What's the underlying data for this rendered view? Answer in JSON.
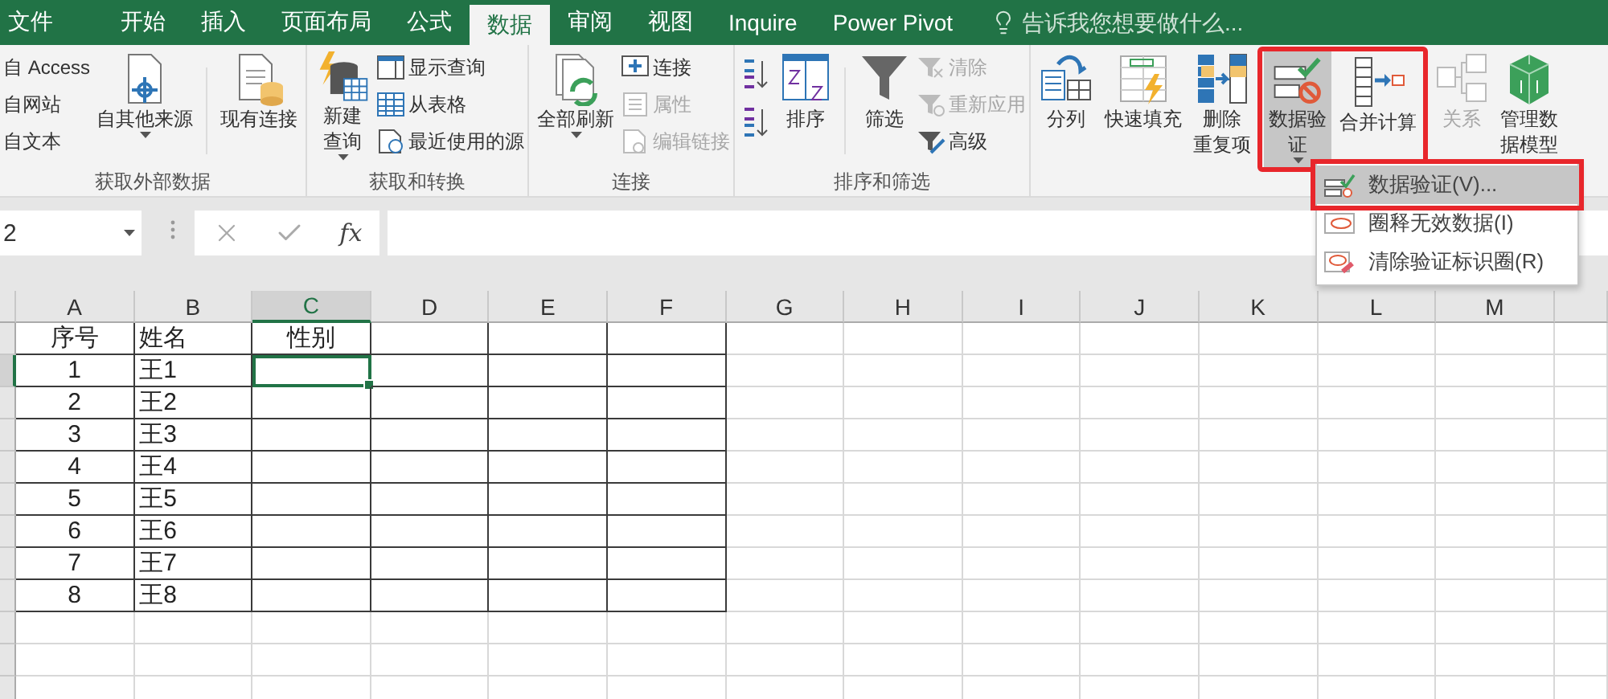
{
  "tabs": [
    {
      "label": "文件",
      "selected": false
    },
    {
      "label": "开始",
      "selected": false
    },
    {
      "label": "插入",
      "selected": false
    },
    {
      "label": "页面布局",
      "selected": false
    },
    {
      "label": "公式",
      "selected": false
    },
    {
      "label": "数据",
      "selected": true
    },
    {
      "label": "审阅",
      "selected": false
    },
    {
      "label": "视图",
      "selected": false
    },
    {
      "label": "Inquire",
      "selected": false
    },
    {
      "label": "Power Pivot",
      "selected": false
    }
  ],
  "tell_me": {
    "placeholder": "告诉我您想要做什么..."
  },
  "ribbon": {
    "groups": [
      {
        "label": "获取外部数据",
        "items": [
          {
            "kind": "stack",
            "items": [
              {
                "label": "自 Access",
                "disabled": false
              },
              {
                "label": "自网站",
                "disabled": false
              },
              {
                "label": "自文本",
                "disabled": false
              }
            ]
          },
          {
            "kind": "large",
            "lines": [
              "自其他来源"
            ],
            "dropdown": true,
            "disabled": false,
            "selected": false,
            "highlighted": false
          },
          {
            "kind": "separator"
          },
          {
            "kind": "large",
            "lines": [
              "现有连接"
            ],
            "dropdown": false,
            "disabled": false,
            "selected": false,
            "highlighted": false
          }
        ]
      },
      {
        "label": "获取和转换",
        "items": [
          {
            "kind": "large",
            "lines": [
              "新建",
              "查询"
            ],
            "dropdown": true,
            "disabled": false,
            "selected": false,
            "highlighted": false
          },
          {
            "kind": "stack",
            "items": [
              {
                "label": "显示查询",
                "disabled": false
              },
              {
                "label": "从表格",
                "disabled": false
              },
              {
                "label": "最近使用的源",
                "disabled": false
              }
            ]
          }
        ]
      },
      {
        "label": "连接",
        "items": [
          {
            "kind": "large",
            "lines": [
              "全部刷新"
            ],
            "dropdown": true,
            "disabled": false,
            "selected": false,
            "highlighted": false
          },
          {
            "kind": "stack",
            "items": [
              {
                "label": "连接",
                "disabled": false
              },
              {
                "label": "属性",
                "disabled": true
              },
              {
                "label": "编辑链接",
                "disabled": true
              }
            ]
          }
        ]
      },
      {
        "label": "排序和筛选",
        "items": [
          {
            "kind": "sort_icons"
          },
          {
            "kind": "large",
            "lines": [
              "排序"
            ],
            "dropdown": false,
            "disabled": false,
            "selected": false,
            "highlighted": false
          },
          {
            "kind": "separator"
          },
          {
            "kind": "large",
            "lines": [
              "筛选"
            ],
            "dropdown": false,
            "disabled": false,
            "selected": false,
            "highlighted": false
          },
          {
            "kind": "stack",
            "items": [
              {
                "label": "清除",
                "disabled": true
              },
              {
                "label": "重新应用",
                "disabled": true
              },
              {
                "label": "高级",
                "disabled": false
              }
            ]
          }
        ]
      },
      {
        "items": [
          {
            "kind": "large",
            "lines": [
              "分列"
            ],
            "dropdown": false,
            "disabled": false,
            "selected": false,
            "highlighted": false
          },
          {
            "kind": "large",
            "lines": [
              "快速填充"
            ],
            "dropdown": false,
            "disabled": false,
            "selected": false,
            "highlighted": false
          },
          {
            "kind": "large",
            "lines": [
              "删除",
              "重复项"
            ],
            "dropdown": false,
            "disabled": false,
            "selected": false,
            "highlighted": false
          },
          {
            "kind": "large",
            "lines": [
              "数据验",
              "证"
            ],
            "dropdown": true,
            "disabled": false,
            "selected": true,
            "highlighted": true
          },
          {
            "kind": "large",
            "lines": [
              "合并计算"
            ],
            "dropdown": false,
            "disabled": false,
            "selected": false,
            "highlighted": true
          },
          {
            "kind": "large",
            "lines": [
              "关系"
            ],
            "dropdown": false,
            "disabled": true,
            "selected": false,
            "highlighted": false
          },
          {
            "kind": "large",
            "lines": [
              "管理数",
              "据模型"
            ],
            "dropdown": false,
            "disabled": false,
            "selected": false,
            "highlighted": false
          }
        ]
      }
    ]
  },
  "menu": {
    "items": [
      {
        "label": "数据验证(V)...",
        "selected": true,
        "highlighted": true
      },
      {
        "label": "圈释无效数据(I)",
        "selected": false,
        "highlighted": false
      },
      {
        "label": "清除验证标识圈(R)",
        "selected": false,
        "highlighted": false
      }
    ]
  },
  "formula_bar": {
    "name_box": "2",
    "function_label": "fx"
  },
  "sheet": {
    "columns": [
      {
        "label": "A",
        "selected": false
      },
      {
        "label": "B",
        "selected": false
      },
      {
        "label": "C",
        "selected": true
      },
      {
        "label": "D",
        "selected": false
      },
      {
        "label": "E",
        "selected": false
      },
      {
        "label": "F",
        "selected": false
      },
      {
        "label": "G",
        "selected": false
      },
      {
        "label": "H",
        "selected": false
      },
      {
        "label": "I",
        "selected": false
      },
      {
        "label": "J",
        "selected": false
      },
      {
        "label": "K",
        "selected": false
      },
      {
        "label": "L",
        "selected": false
      },
      {
        "label": "M",
        "selected": false
      }
    ],
    "rows": [
      {
        "selected": false,
        "bordered": true,
        "cells": [
          {
            "text": "序号",
            "selected": false
          },
          {
            "text": "姓名",
            "selected": false
          },
          {
            "text": "性别",
            "selected": false
          }
        ]
      },
      {
        "selected": true,
        "bordered": true,
        "cells": [
          {
            "text": "1",
            "selected": false
          },
          {
            "text": "王1",
            "selected": false
          },
          {
            "selected": true
          }
        ]
      },
      {
        "selected": false,
        "bordered": true,
        "cells": [
          {
            "text": "2",
            "selected": false
          },
          {
            "text": "王2",
            "selected": false
          }
        ]
      },
      {
        "selected": false,
        "bordered": true,
        "cells": [
          {
            "text": "3",
            "selected": false
          },
          {
            "text": "王3",
            "selected": false
          }
        ]
      },
      {
        "selected": false,
        "bordered": true,
        "cells": [
          {
            "text": "4",
            "selected": false
          },
          {
            "text": "王4",
            "selected": false
          }
        ]
      },
      {
        "selected": false,
        "bordered": true,
        "cells": [
          {
            "text": "5",
            "selected": false
          },
          {
            "text": "王5",
            "selected": false
          }
        ]
      },
      {
        "selected": false,
        "bordered": true,
        "cells": [
          {
            "text": "6",
            "selected": false
          },
          {
            "text": "王6",
            "selected": false
          }
        ]
      },
      {
        "selected": false,
        "bordered": true,
        "cells": [
          {
            "text": "7",
            "selected": false
          },
          {
            "text": "王7",
            "selected": false
          }
        ]
      },
      {
        "selected": false,
        "bordered": true,
        "cells": [
          {
            "text": "8",
            "selected": false
          },
          {
            "text": "王8",
            "selected": false
          }
        ]
      }
    ]
  }
}
